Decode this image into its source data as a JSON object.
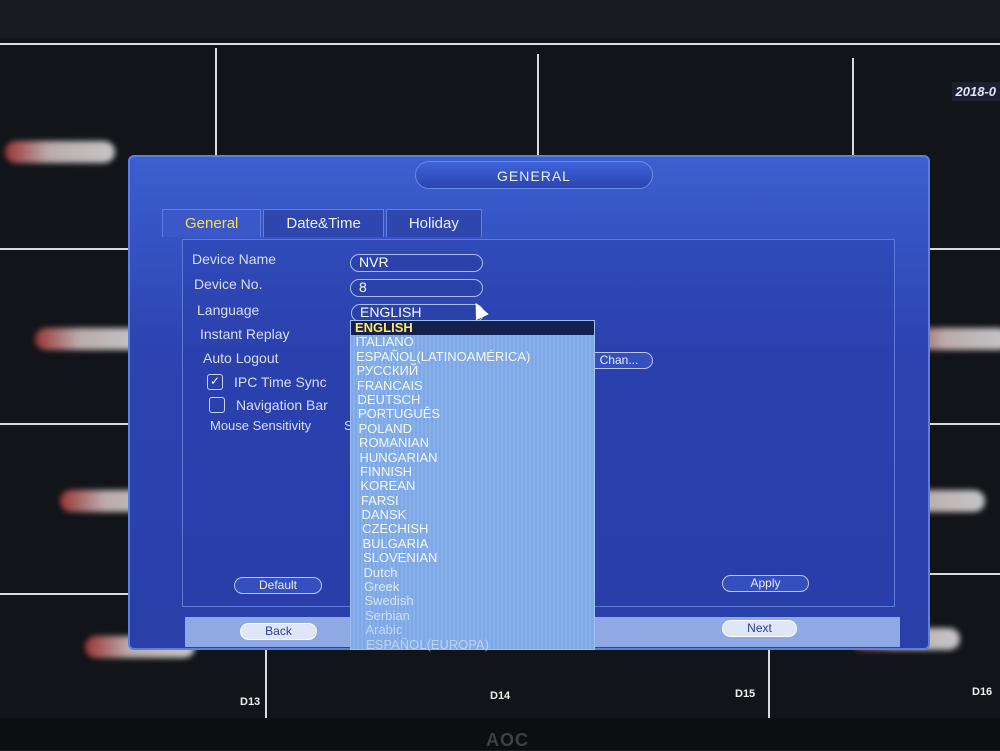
{
  "monitor": {
    "brand": "AOC",
    "timestamp": "2018-0",
    "channels": [
      "D13",
      "D14",
      "D15",
      "D16"
    ]
  },
  "dialog": {
    "title": "GENERAL",
    "tabs": [
      {
        "label": "General",
        "active": true
      },
      {
        "label": "Date&Time",
        "active": false
      },
      {
        "label": "Holiday",
        "active": false
      }
    ],
    "fields": {
      "device_name": {
        "label": "Device Name",
        "value": "NVR"
      },
      "device_no": {
        "label": "Device No.",
        "value": "8"
      },
      "language": {
        "label": "Language",
        "value": "ENGLISH"
      },
      "instant_replay": {
        "label": "Instant Replay"
      },
      "auto_logout": {
        "label": "Auto Logout",
        "button": "Chan..."
      },
      "ipc_time_sync": {
        "label": "IPC Time Sync",
        "checked": true
      },
      "navigation_bar": {
        "label": "Navigation Bar",
        "checked": false
      },
      "mouse_sensitivity": {
        "label": "Mouse Sensitivity",
        "value_partial": "S"
      }
    },
    "buttons": {
      "default": "Default",
      "apply": "Apply",
      "back": "Back",
      "next": "Next"
    },
    "language_options": [
      "ENGLISH",
      "ITALIANO",
      "ESPAÑOL(LATINOAMÉRICA)",
      "РУССКИЙ",
      "FRANCAIS",
      "DEUTSCH",
      "PORTUGUÊS",
      "POLAND",
      "ROMANIAN",
      "HUNGARIAN",
      "FINNISH",
      "KOREAN",
      "FARSI",
      "DANSK",
      "CZECHISH",
      "BULGARIA",
      "SLOVENIAN",
      "Dutch",
      "Greek",
      "Swedish",
      "Serbian",
      "Arabic",
      "ESPAÑOL(EUROPA)"
    ],
    "selected_language": "ENGLISH"
  },
  "colors": {
    "dialog": "#2c43b0",
    "highlight": "#ffe03a",
    "dropdown": "#82abe7"
  }
}
